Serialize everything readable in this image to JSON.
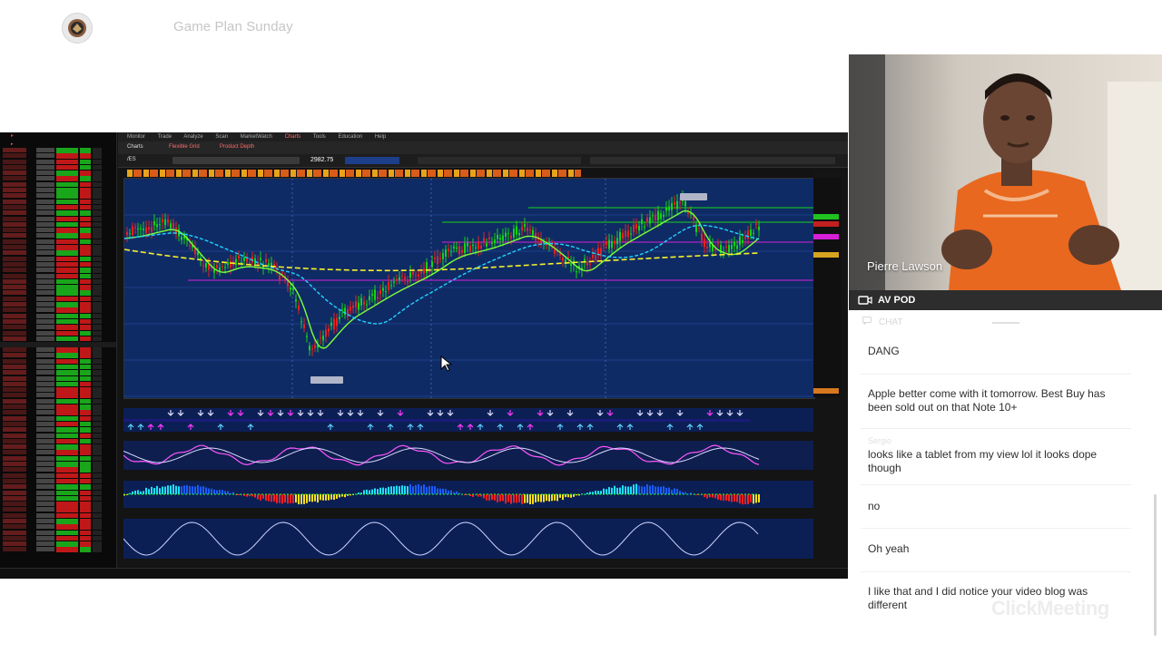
{
  "header": {
    "title": "Game Plan Sunday",
    "logo_icon": "logo-icon"
  },
  "presenter": {
    "name": "Pierre Lawson"
  },
  "pod": {
    "label": "AV POD",
    "icon": "video-camera-icon"
  },
  "chat": {
    "label": "CHAT",
    "messages": [
      {
        "user": "",
        "text": "DANG"
      },
      {
        "user": "",
        "text": "Apple better come with it tomorrow. Best Buy has been sold out on that Note 10+"
      },
      {
        "user": "Sergio",
        "text": "looks like a tablet from my view lol it looks dope though"
      },
      {
        "user": "",
        "text": "no"
      },
      {
        "user": "",
        "text": "Oh yeah"
      },
      {
        "user": "",
        "text": "I like that and I did notice your video blog was different"
      }
    ],
    "watermark": "ClickMeeting"
  },
  "screen_share": {
    "platform_menu": [
      "Monitor",
      "Trade",
      "Analyze",
      "Scan",
      "MarketWatch",
      "Charts",
      "Tools",
      "Education",
      "Help"
    ],
    "chart_tabs": [
      "Charts",
      "Flexible Grid",
      "Product Depth"
    ],
    "symbol": "/ES",
    "price": "2982.75",
    "colors": {
      "chart_bg": "#0f2b66",
      "up": "#16d316",
      "down": "#e82222",
      "ma_fast": "#7cff3a",
      "ma_slow": "#21d4ff",
      "ma_long": "#f7f22a"
    }
  }
}
